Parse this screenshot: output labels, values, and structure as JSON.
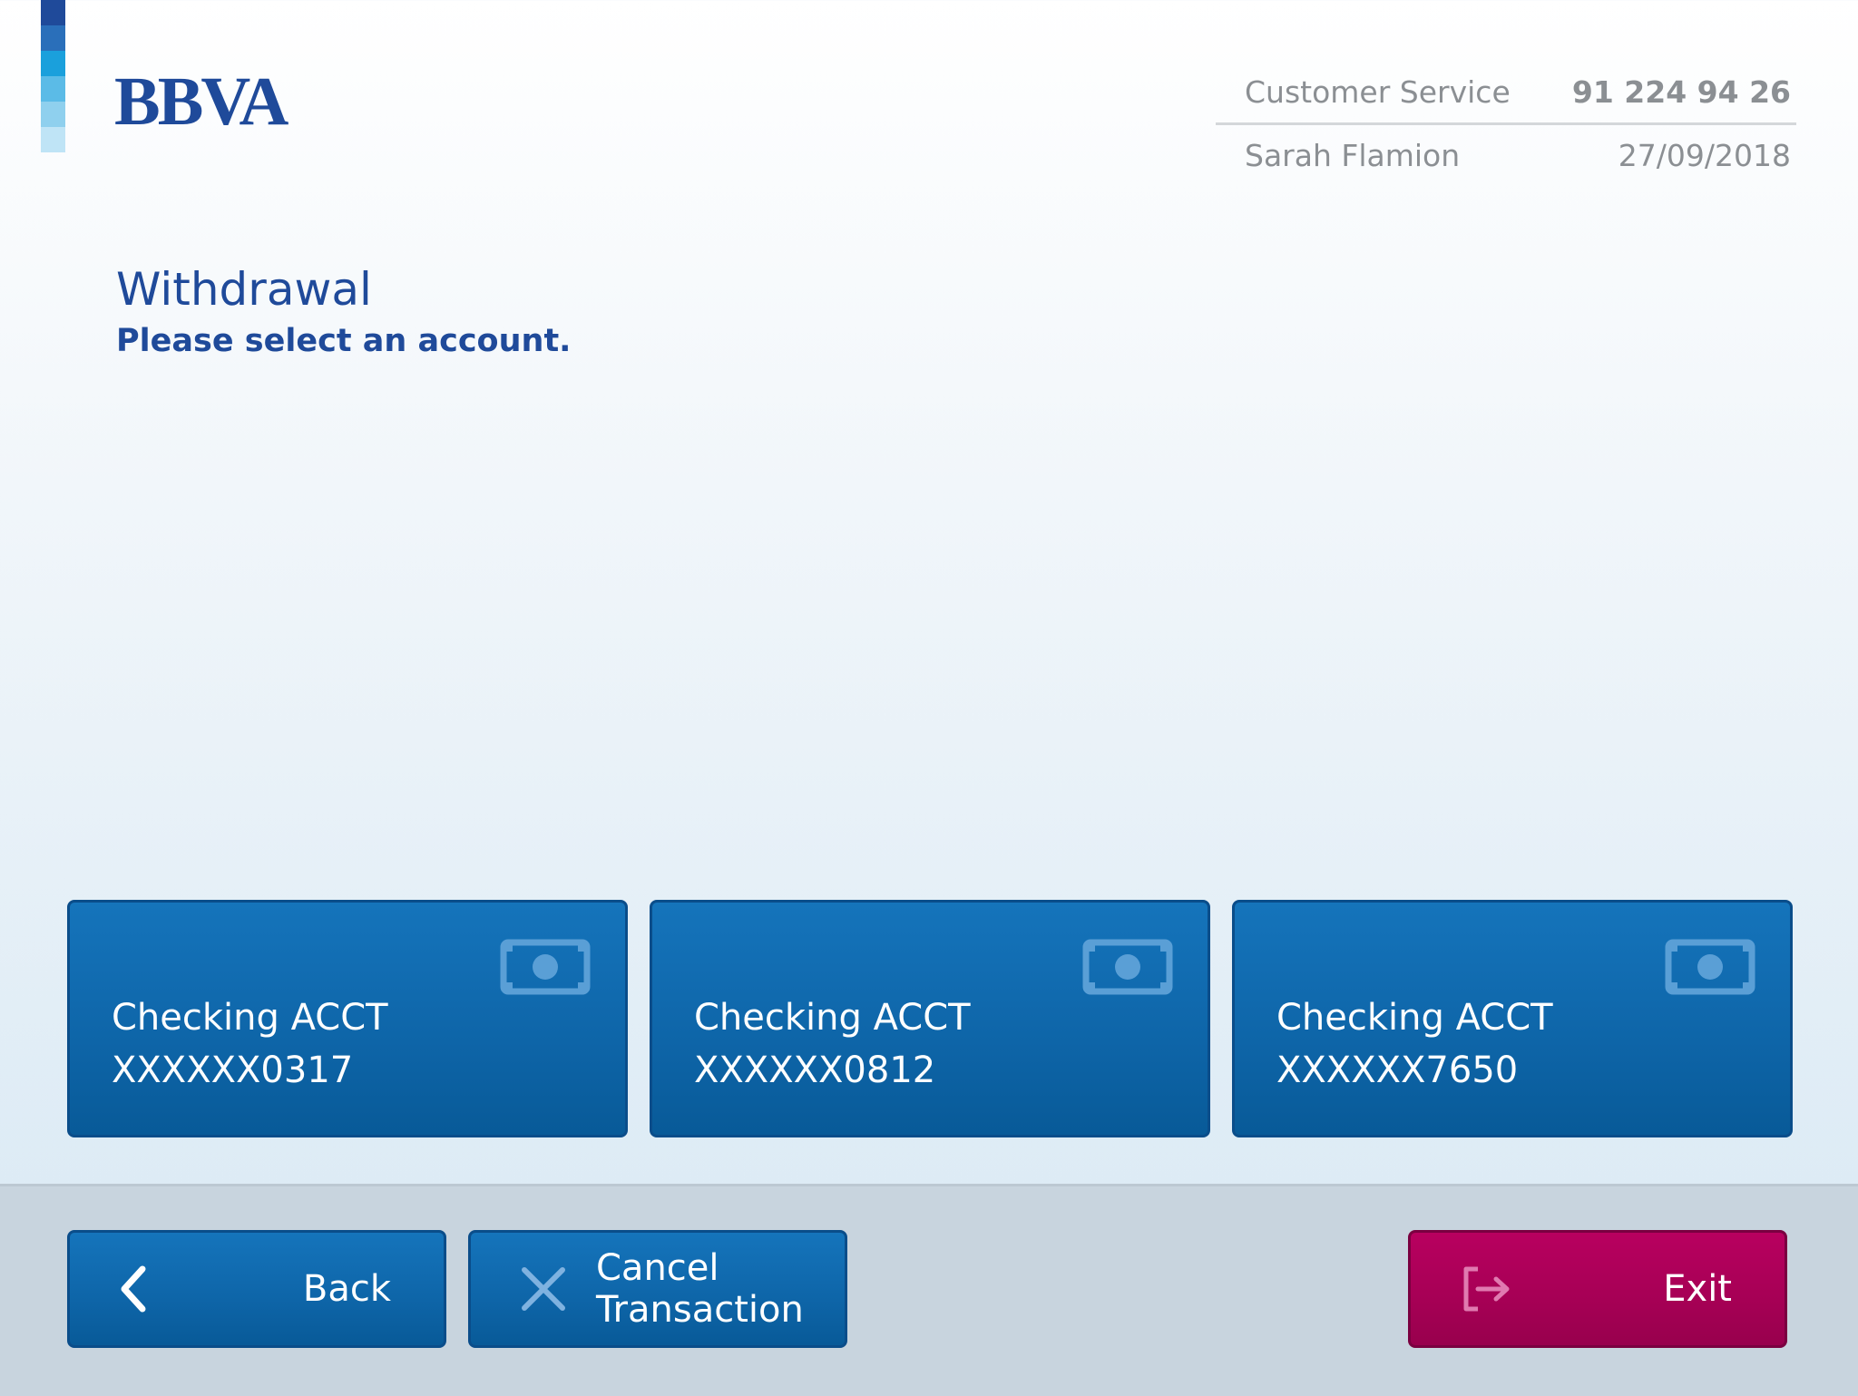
{
  "brand": {
    "logo_text": "BBVA",
    "strip_colors": [
      "#1f4a9a",
      "#2a6fba",
      "#1aa0dc",
      "#5bbbe7",
      "#8fd0ee",
      "#bfe4f6"
    ]
  },
  "header": {
    "service_label": "Customer Service",
    "service_phone": "91 224 94 26",
    "user_name": "Sarah Flamion",
    "date": "27/09/2018"
  },
  "page": {
    "title": "Withdrawal",
    "subtitle": "Please select an account."
  },
  "accounts": [
    {
      "name": "Checking ACCT",
      "number": "XXXXXX0317",
      "icon": "cash-icon"
    },
    {
      "name": "Checking ACCT",
      "number": "XXXXXX0812",
      "icon": "cash-icon"
    },
    {
      "name": "Checking ACCT",
      "number": "XXXXXX7650",
      "icon": "cash-icon"
    }
  ],
  "footer": {
    "back_label": "Back",
    "cancel_label_line1": "Cancel",
    "cancel_label_line2": "Transaction",
    "exit_label": "Exit"
  },
  "colors": {
    "brand_blue": "#1f4a9a",
    "button_blue": "#0e65a8",
    "exit_magenta": "#a60055",
    "footer_bg": "#c8d4de"
  }
}
